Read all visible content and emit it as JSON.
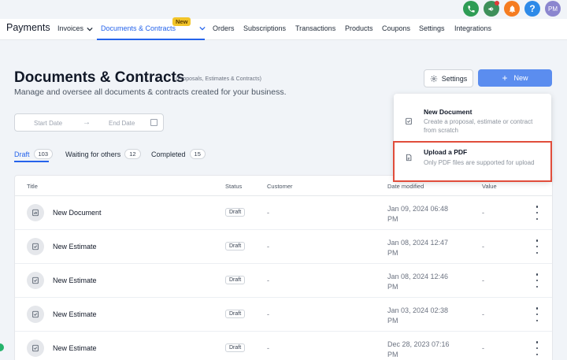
{
  "header": {
    "brand": "Payments",
    "nav": [
      {
        "label": "Invoices"
      },
      {
        "label": "Documents & Contracts",
        "badge": "New"
      },
      {
        "label": "Orders"
      },
      {
        "label": "Subscriptions"
      },
      {
        "label": "Transactions"
      },
      {
        "label": "Products"
      },
      {
        "label": "Coupons"
      },
      {
        "label": "Settings"
      },
      {
        "label": "Integrations"
      }
    ],
    "avatar_initials": "PM",
    "help_label": "?"
  },
  "page": {
    "title": "Documents & Contracts",
    "title_sub": "(Proposals, Estimates & Contracts)",
    "description": "Manage and oversee all documents & contracts created for your business.",
    "settings_label": "Settings",
    "new_label": "New",
    "new_plus": "+"
  },
  "date_filter": {
    "start_placeholder": "Start Date",
    "end_placeholder": "End Date",
    "arrow": "→"
  },
  "tabs": [
    {
      "label": "Draft",
      "count": "103"
    },
    {
      "label": "Waiting for others",
      "count": "12"
    },
    {
      "label": "Completed",
      "count": "15"
    }
  ],
  "table": {
    "columns": [
      "Title",
      "Status",
      "Customer",
      "Date modified",
      "Value"
    ],
    "rows": [
      {
        "title": "New Document",
        "status": "Draft",
        "customer": "-",
        "date": "Jan 09, 2024 06:48 PM",
        "value": "-",
        "icon": "document-chart-icon"
      },
      {
        "title": "New Estimate",
        "status": "Draft",
        "customer": "-",
        "date": "Jan 08, 2024 12:47 PM",
        "value": "-",
        "icon": "estimate-check-icon"
      },
      {
        "title": "New Estimate",
        "status": "Draft",
        "customer": "-",
        "date": "Jan 08, 2024 12:46 PM",
        "value": "-",
        "icon": "estimate-check-icon"
      },
      {
        "title": "New Estimate",
        "status": "Draft",
        "customer": "-",
        "date": "Jan 03, 2024 02:38 PM",
        "value": "-",
        "icon": "estimate-check-icon"
      },
      {
        "title": "New Estimate",
        "status": "Draft",
        "customer": "-",
        "date": "Dec 28, 2023 07:16 PM",
        "value": "-",
        "icon": "estimate-check-icon"
      }
    ]
  },
  "new_menu": {
    "items": [
      {
        "title": "New Document",
        "desc": "Create a proposal, estimate or contract from scratch",
        "icon": "document-check-icon"
      },
      {
        "title": "Upload a PDF",
        "desc": "Only PDF files are supported for upload",
        "icon": "pdf-file-icon"
      }
    ]
  },
  "colors": {
    "accent": "#2563eb",
    "new_button": "#5b8def",
    "badge_new": "#f2c428",
    "highlight": "#e14d3b"
  }
}
